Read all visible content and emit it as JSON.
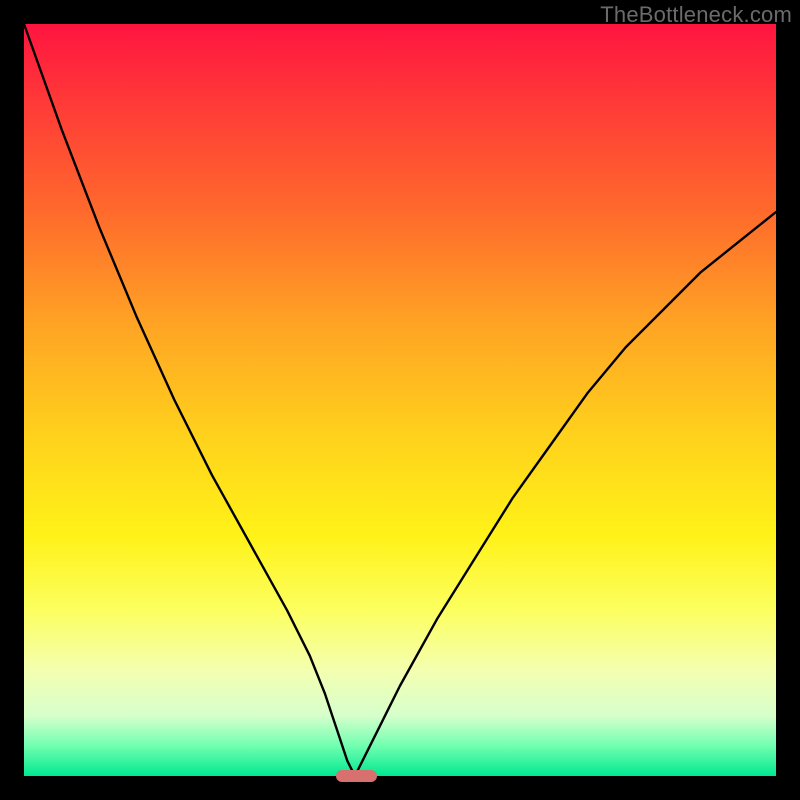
{
  "watermark": "TheBottleneck.com",
  "chart_data": {
    "type": "line",
    "title": "",
    "xlabel": "",
    "ylabel": "",
    "xlim": [
      0,
      100
    ],
    "ylim": [
      0,
      100
    ],
    "grid": false,
    "legend": false,
    "annotations": [],
    "series": [
      {
        "name": "curve",
        "x": [
          0,
          5,
          10,
          15,
          20,
          25,
          30,
          35,
          38,
          40,
          41,
          42,
          43,
          44,
          45,
          46,
          48,
          50,
          55,
          60,
          65,
          70,
          75,
          80,
          85,
          90,
          95,
          100
        ],
        "values": [
          100,
          86,
          73,
          61,
          50,
          40,
          31,
          22,
          16,
          11,
          8,
          5,
          2,
          0,
          2,
          4,
          8,
          12,
          21,
          29,
          37,
          44,
          51,
          57,
          62,
          67,
          71,
          75
        ]
      }
    ],
    "optimum_marker": {
      "x_start": 41.5,
      "x_end": 47,
      "y": 0
    },
    "background_gradient": {
      "top": "#ff1440",
      "mid": "#ffd21c",
      "bottom": "#00e890"
    },
    "curve_color": "#000000",
    "marker_color": "#d87070"
  }
}
